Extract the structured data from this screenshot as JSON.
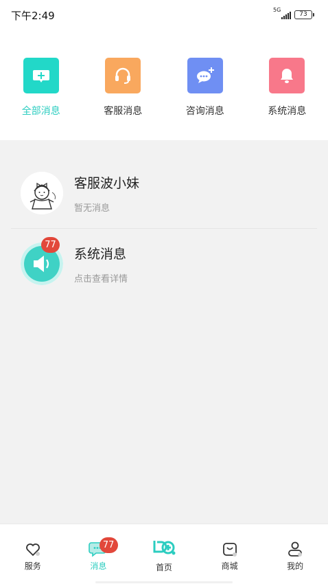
{
  "status_bar": {
    "time": "下午2:49",
    "network": "5G",
    "battery": "73"
  },
  "categories": [
    {
      "label": "全部消息",
      "icon": "message-square-icon",
      "color": "#22d8c8",
      "active": true
    },
    {
      "label": "客服消息",
      "icon": "headset-icon",
      "color": "#f9a85e",
      "active": false
    },
    {
      "label": "咨询消息",
      "icon": "chat-plus-icon",
      "color": "#6f8ff3",
      "active": false
    },
    {
      "label": "系统消息",
      "icon": "bell-icon",
      "color": "#f8788a",
      "active": false
    }
  ],
  "messages": [
    {
      "title": "客服波小妹",
      "subtitle": "暂无消息",
      "avatar": "cartoon-girl-avatar"
    },
    {
      "title": "系统消息",
      "subtitle": "点击查看详情",
      "avatar": "speaker-icon",
      "badge": "77"
    }
  ],
  "tabbar": {
    "items": [
      {
        "label": "服务",
        "icon": "heart-icon"
      },
      {
        "label": "消息",
        "icon": "chat-bubble-icon",
        "badge": "77",
        "active": true
      },
      {
        "label": "首页",
        "icon": "home-logo-icon"
      },
      {
        "label": "商城",
        "icon": "shopping-bag-icon"
      },
      {
        "label": "我的",
        "icon": "person-icon"
      }
    ]
  },
  "colors": {
    "accent": "#2ccdc0",
    "badge": "#e2483b",
    "background": "#f2f2f2"
  }
}
